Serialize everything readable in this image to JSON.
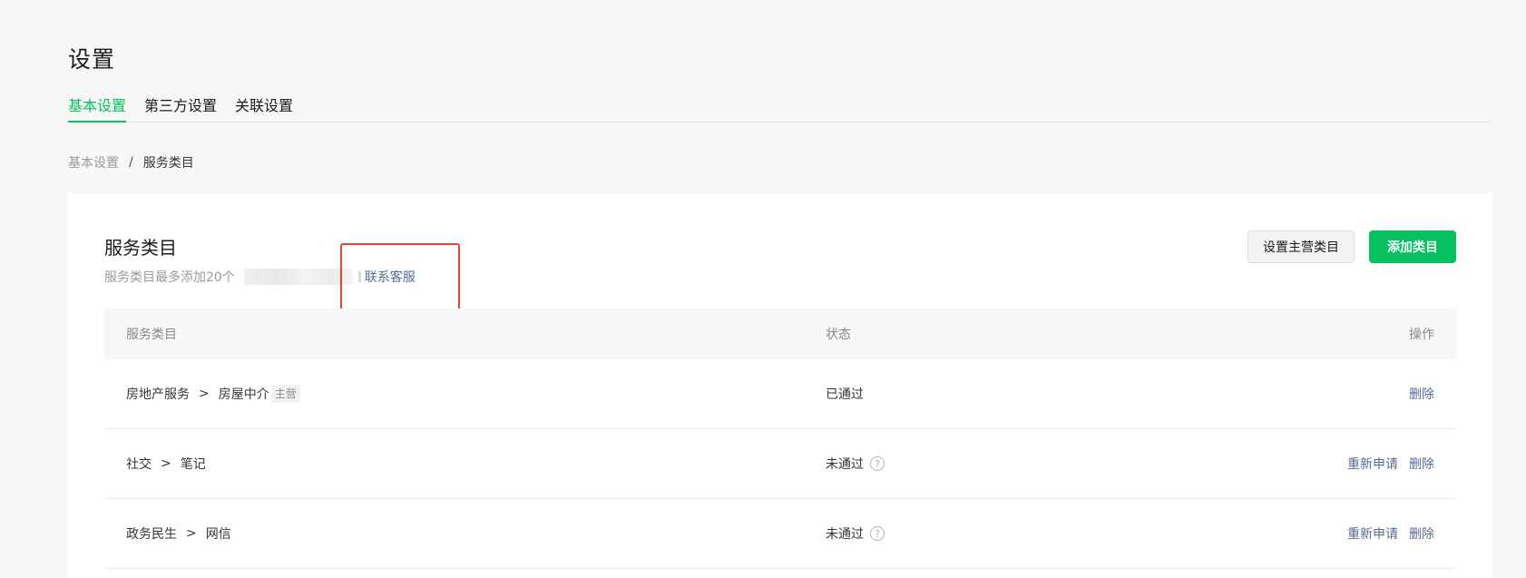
{
  "page": {
    "title": "设置"
  },
  "tabs": [
    {
      "label": "基本设置",
      "active": true
    },
    {
      "label": "第三方设置",
      "active": false
    },
    {
      "label": "关联设置",
      "active": false
    }
  ],
  "breadcrumb": {
    "parent": "基本设置",
    "separator": "/",
    "current": "服务类目"
  },
  "card": {
    "title": "服务类目",
    "description": "服务类目最多添加20个",
    "contact_link": "联系客服",
    "set_main_button": "设置主营类目",
    "add_button": "添加类目"
  },
  "table": {
    "headers": {
      "category": "服务类目",
      "status": "状态",
      "ops": "操作"
    },
    "rows": [
      {
        "parent": "房地产服务",
        "arrow": ">",
        "child": "房屋中介",
        "tag": "主营",
        "status": "已通过",
        "reapply": "",
        "delete": "删除"
      },
      {
        "parent": "社交",
        "arrow": ">",
        "child": "笔记",
        "tag": "",
        "status": "未通过",
        "reapply": "重新申请",
        "delete": "删除"
      },
      {
        "parent": "政务民生",
        "arrow": ">",
        "child": "网信",
        "tag": "",
        "status": "未通过",
        "reapply": "重新申请",
        "delete": "删除"
      }
    ]
  },
  "colors": {
    "brand": "#07c160",
    "link": "#576b95",
    "highlight": "#e84338"
  },
  "icons": {
    "help": "question-circle-icon"
  }
}
